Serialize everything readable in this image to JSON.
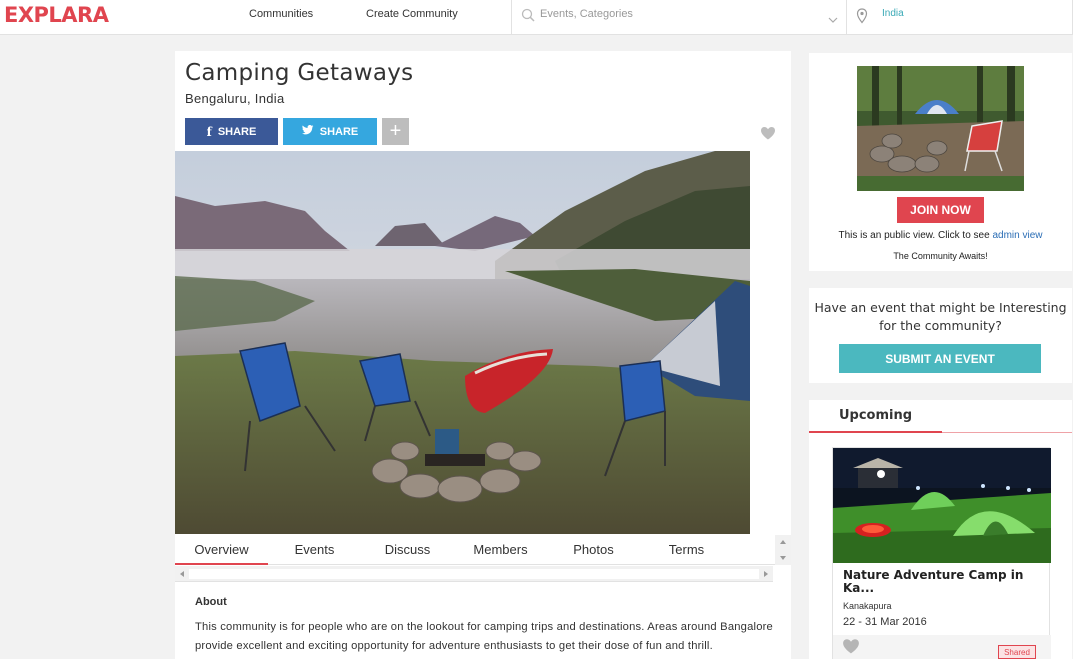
{
  "header": {
    "logo_text": "EXPLARA",
    "nav": [
      "Communities",
      "Create Community"
    ],
    "search_placeholder": "Events, Categories",
    "location": "India"
  },
  "community": {
    "title": "Camping Getaways",
    "location": "Bengaluru, India",
    "share_facebook": "SHARE",
    "share_twitter": "SHARE",
    "more_label": "+"
  },
  "tabs": [
    "Overview",
    "Events",
    "Discuss",
    "Members",
    "Photos",
    "Terms"
  ],
  "about": {
    "heading": "About",
    "text": "This community is for people who are on the lookout for camping trips and destinations. Areas around Bangalore provide excellent and exciting opportunity for adventure enthusiasts to get their dose of fun and thrill."
  },
  "sidebar": {
    "join_label": "JOIN NOW",
    "public_view_text": "This is an public view. Click to see",
    "admin_view_link": "admin view",
    "awaits_text": "The Community Awaits!",
    "event_question": "Have an event that might be Interesting for the community?",
    "submit_label": "SUBMIT AN EVENT",
    "upcoming_tab": "Upcoming",
    "event": {
      "title": "Nature Adventure Camp in Ka...",
      "location": "Kanakapura",
      "dates": "22 - 31 Mar 2016",
      "badge": "Shared"
    }
  },
  "colors": {
    "brand_red": "#e0454f",
    "facebook": "#3b5998",
    "twitter": "#35a7df",
    "teal": "#4bb8bf",
    "link": "#2a6db5"
  }
}
